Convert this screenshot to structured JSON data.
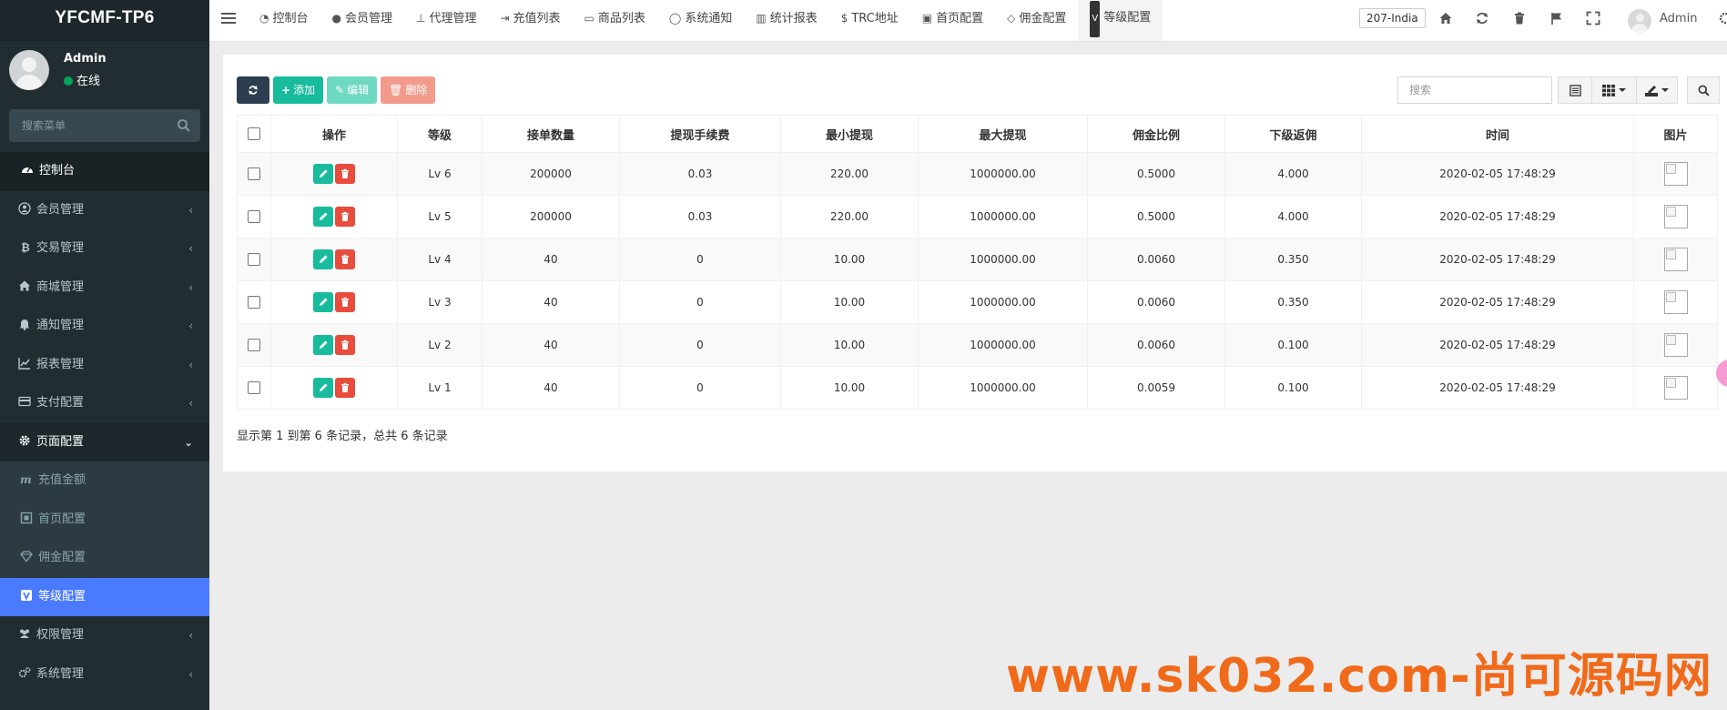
{
  "brand": "YFCMF-TP6",
  "user": {
    "name": "Admin",
    "status": "在线"
  },
  "sidebar": {
    "search_placeholder": "搜索菜单",
    "items": [
      {
        "label": "控制台",
        "icon": "dashboard-icon"
      },
      {
        "label": "会员管理",
        "icon": "user-icon"
      },
      {
        "label": "交易管理",
        "icon": "bitcoin-icon"
      },
      {
        "label": "商城管理",
        "icon": "home-icon"
      },
      {
        "label": "通知管理",
        "icon": "bell-icon"
      },
      {
        "label": "报表管理",
        "icon": "line-chart-icon"
      },
      {
        "label": "支付配置",
        "icon": "credit-card-icon"
      },
      {
        "label": "页面配置",
        "icon": "gear-icon"
      }
    ],
    "sub_items": [
      {
        "label": "充值金额",
        "icon": "m-icon"
      },
      {
        "label": "首页配置",
        "icon": "home-square-icon"
      },
      {
        "label": "佣金配置",
        "icon": "diamond-icon"
      },
      {
        "label": "等级配置",
        "icon": "v-icon"
      }
    ],
    "after_items": [
      {
        "label": "权限管理",
        "icon": "group-icon"
      },
      {
        "label": "系统管理",
        "icon": "cogs-icon"
      }
    ]
  },
  "tabs": [
    {
      "label": "控制台",
      "icon": "dashboard-icon"
    },
    {
      "label": "会员管理",
      "icon": "user-icon"
    },
    {
      "label": "代理管理",
      "icon": "sitemap-icon"
    },
    {
      "label": "充值列表",
      "icon": "sign-in-icon"
    },
    {
      "label": "商品列表",
      "icon": "desktop-icon"
    },
    {
      "label": "系统通知",
      "icon": "comment-icon"
    },
    {
      "label": "统计报表",
      "icon": "bar-chart-icon"
    },
    {
      "label": "TRC地址",
      "icon": "dollar-icon"
    },
    {
      "label": "首页配置",
      "icon": "home-square-icon"
    },
    {
      "label": "佣金配置",
      "icon": "diamond-icon"
    },
    {
      "label": "等级配置",
      "icon": "v-icon"
    }
  ],
  "top": {
    "lang": "207-India",
    "admin": "Admin"
  },
  "toolbar": {
    "add": "添加",
    "edit": "编辑",
    "delete": "删除",
    "search_placeholder": "搜索"
  },
  "table": {
    "headers": [
      "操作",
      "等级",
      "接单数量",
      "提现手续费",
      "最小提现",
      "最大提现",
      "佣金比例",
      "下级返佣",
      "时间",
      "图片"
    ],
    "rows": [
      [
        "Lv 6",
        "200000",
        "0.03",
        "220.00",
        "1000000.00",
        "0.5000",
        "4.000",
        "2020-02-05 17:48:29"
      ],
      [
        "Lv 5",
        "200000",
        "0.03",
        "220.00",
        "1000000.00",
        "0.5000",
        "4.000",
        "2020-02-05 17:48:29"
      ],
      [
        "Lv 4",
        "40",
        "0",
        "10.00",
        "1000000.00",
        "0.0060",
        "0.350",
        "2020-02-05 17:48:29"
      ],
      [
        "Lv 3",
        "40",
        "0",
        "10.00",
        "1000000.00",
        "0.0060",
        "0.350",
        "2020-02-05 17:48:29"
      ],
      [
        "Lv 2",
        "40",
        "0",
        "10.00",
        "1000000.00",
        "0.0060",
        "0.100",
        "2020-02-05 17:48:29"
      ],
      [
        "Lv 1",
        "40",
        "0",
        "10.00",
        "1000000.00",
        "0.0059",
        "0.100",
        "2020-02-05 17:48:29"
      ]
    ],
    "summary": "显示第 1 到第 6 条记录，总共 6 条记录"
  },
  "watermark": "www.sk032.com-尚可源码网"
}
